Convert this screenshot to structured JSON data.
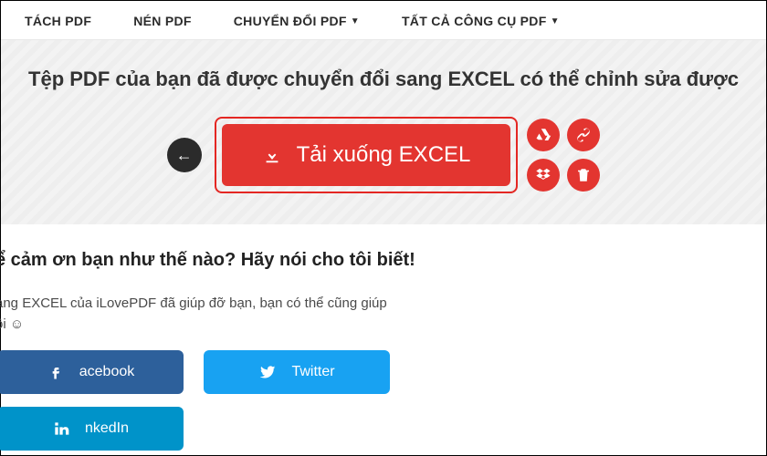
{
  "nav": {
    "split": "TÁCH PDF",
    "compress": "NÉN PDF",
    "convert": "CHUYỂN ĐỔI PDF",
    "all_tools": "TẤT CẢ CÔNG CỤ PDF"
  },
  "hero": {
    "title": "Tệp PDF của bạn đã được chuyển đổi sang EXCEL có thể chỉnh sửa được",
    "download_label": "Tải xuống EXCEL"
  },
  "thanks": {
    "heading": "ể cảm ơn bạn như thế nào? Hãy nói cho tôi biết!",
    "sub_line1": "ang EXCEL của iLovePDF đã giúp đỡ bạn, bạn có thể cũng giúp",
    "sub_line2": "ôi ☺"
  },
  "share": {
    "facebook": "acebook",
    "twitter": "Twitter",
    "linkedin": "nkedIn"
  }
}
